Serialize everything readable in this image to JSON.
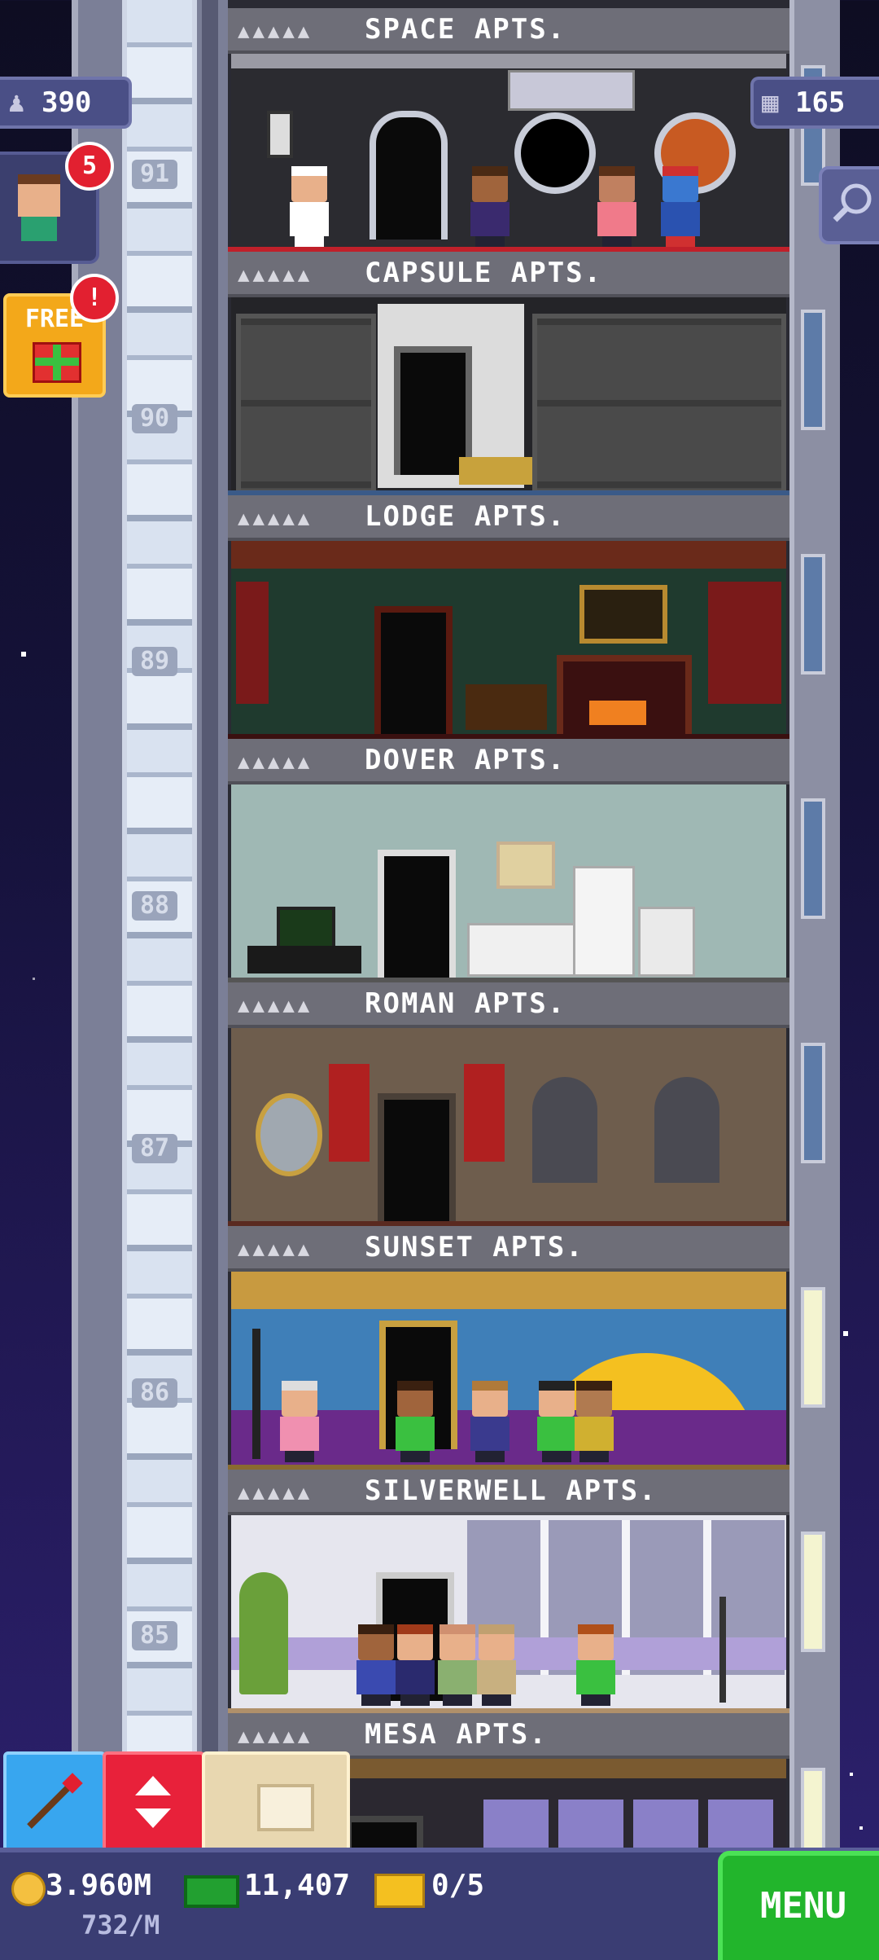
{
  "hud": {
    "population": "390",
    "bux_top": "165",
    "notification_count": "5",
    "free_label": "FREE",
    "free_alert": "!"
  },
  "floors": [
    {
      "number": "91",
      "name": "SPACE APTS.",
      "rating": "▲▲▲▲▲",
      "color": "#2b2b30"
    },
    {
      "number": "90",
      "name": "CAPSULE APTS.",
      "rating": "▲▲▲▲▲",
      "color": "#242428"
    },
    {
      "number": "89",
      "name": "LODGE APTS.",
      "rating": "▲▲▲▲▲",
      "color": "#1f3a2e"
    },
    {
      "number": "88",
      "name": "DOVER APTS.",
      "rating": "▲▲▲▲▲",
      "color": "#9fb8b4"
    },
    {
      "number": "87",
      "name": "ROMAN APTS.",
      "rating": "▲▲▲▲▲",
      "color": "#6e5d4d"
    },
    {
      "number": "86",
      "name": "SUNSET APTS.",
      "rating": "▲▲▲▲▲",
      "color": "#3f7fb8"
    },
    {
      "number": "85",
      "name": "SILVERWELL APTS.",
      "rating": "▲▲▲▲▲",
      "color": "#e6e6ee"
    },
    {
      "number": "",
      "name": "MESA APTS.",
      "rating": "▲▲▲▲▲",
      "color": "#2b2830"
    }
  ],
  "footer": {
    "coins": "3.960M",
    "coin_rate": "732/M",
    "bux": "11,407",
    "tickets": "0/5",
    "menu_label": "MENU"
  },
  "colors": {
    "menu_green": "#22b52c",
    "elevator_red": "#e8213a",
    "paint_blue": "#38a6ef",
    "storage_tan": "#e8d7b0"
  }
}
